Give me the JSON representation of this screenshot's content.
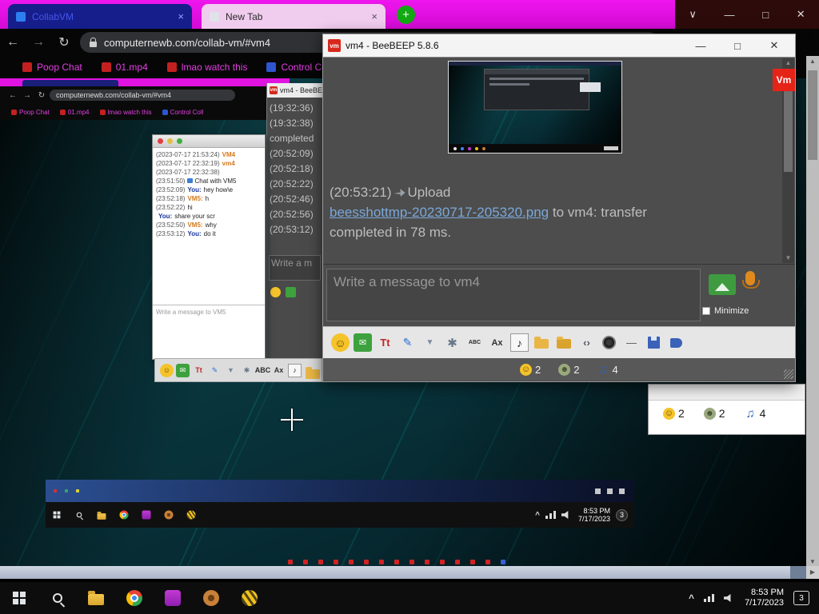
{
  "glyphs": {
    "back": "←",
    "fwd": "→",
    "reload": "↻",
    "plus": "+",
    "chev": "∨",
    "min": "—",
    "max": "□",
    "close": "✕",
    "tabclose": "×",
    "up": "▲",
    "down": "▼",
    "caret": "^",
    "right": "▶"
  },
  "browser": {
    "tab1": "CollabVM",
    "tab2": "New Tab",
    "address": "computernewb.com/collab-vm/#vm4",
    "bookmarks": [
      {
        "label": "Poop Chat",
        "cls": "bm-red"
      },
      {
        "label": "01.mp4",
        "cls": "bm-red"
      },
      {
        "label": "lmao watch this",
        "cls": "bm-red"
      },
      {
        "label": "Control Coll",
        "cls": "bm-blue"
      }
    ]
  },
  "page": {
    "logo": "Vm"
  },
  "beebeep": {
    "title": "vm4 - BeeBEEP 5.8.6",
    "icon_text": "vm",
    "msg": {
      "time": "(20:53:21)",
      "action": "Upload",
      "link": "beesshottmp-20230717-205320.png",
      "rest": "to vm4: transfer completed in 78 ms."
    },
    "placeholder": "Write a message to vm4",
    "minimize": "Minimize",
    "toolbar": [
      {
        "name": "emoticon-icon",
        "glyph": "☺",
        "cls": "i-smiley"
      },
      {
        "name": "send-file-icon",
        "glyph": "✉",
        "cls": "i-env"
      },
      {
        "name": "font-icon",
        "glyph": "Tt",
        "cls": "i-font"
      },
      {
        "name": "font-color-icon",
        "glyph": "✎",
        "cls": "i-pen"
      },
      {
        "name": "filter-icon",
        "glyph": "▼",
        "cls": "i-funnel"
      },
      {
        "name": "settings-icon",
        "glyph": "✱",
        "cls": "i-gear"
      },
      {
        "name": "spellcheck-icon",
        "glyph": "ABC",
        "cls": "i-abc"
      },
      {
        "name": "clear-format-icon",
        "glyph": "Ax",
        "cls": "i-ax"
      },
      {
        "name": "sound-icon",
        "glyph": "♪",
        "cls": "i-note"
      },
      {
        "name": "folder-add-icon",
        "glyph": "",
        "cls": "i-folder1"
      },
      {
        "name": "folder-send-icon",
        "glyph": "",
        "cls": "i-folder2"
      },
      {
        "name": "code-icon",
        "glyph": "‹›",
        "cls": "i-code"
      },
      {
        "name": "screenshot-icon",
        "glyph": "",
        "cls": "i-lens"
      },
      {
        "name": "horizontal-rule-icon",
        "glyph": "—",
        "cls": "i-hr"
      },
      {
        "name": "save-chat-icon",
        "glyph": "",
        "cls": "i-save"
      },
      {
        "name": "plugin-icon",
        "glyph": "",
        "cls": "i-boot"
      }
    ],
    "counts": [
      {
        "v": "2",
        "cls": "c-smiley",
        "name": "online-users-count"
      },
      {
        "v": "2",
        "cls": "c-users",
        "name": "connected-users-count"
      },
      {
        "v": "4",
        "cls": "c-notes",
        "name": "unread-chats-count"
      }
    ]
  },
  "beebeep_back": {
    "title": "vm4 - BeeBEE",
    "lines": [
      "(19:32:36)",
      "(19:32:38)",
      "completed",
      "(20:52:09)",
      "(20:52:18)",
      "(20:52:22)",
      "(20:52:46)",
      "(20:52:56)",
      "(20:53:12)"
    ],
    "placeholder": "Write a m"
  },
  "vm5": {
    "placeholder": "Write a message to VM5",
    "lines": [
      {
        "time": "(2023-07-17 21:53:24)",
        "who": "VM4",
        "wcls": "who-orange",
        "text": ""
      },
      {
        "time": "(2023-07-17 22:32:19)",
        "who": "vm4",
        "wcls": "who-orange",
        "text": ""
      },
      {
        "time": "(2023-07-17 22:32:38)",
        "who": "",
        "text": ""
      },
      {
        "time": "(23:51:50)",
        "who": "",
        "icls": "chaticon",
        "text": "Chat with VM5"
      },
      {
        "time": "(23:52:09)",
        "who": "You:",
        "wcls": "who-blue",
        "text": "hey how\\e"
      },
      {
        "time": "(23:52:18)",
        "who": "VM5:",
        "wcls": "who-orange",
        "text": "h"
      },
      {
        "time": "(23:52:22)",
        "who": "",
        "text": "hi"
      },
      {
        "time": "",
        "who": "You:",
        "wcls": "who-blue",
        "text": "share your scr"
      },
      {
        "time": "(23:52:50)",
        "who": "VM5:",
        "wcls": "who-orange",
        "text": "why"
      },
      {
        "time": "(23:53:12)",
        "who": "You:",
        "wcls": "who-blue",
        "text": "do it"
      }
    ]
  },
  "tray": {
    "time": "8:53 PM",
    "date": "7/17/2023",
    "badge": "3"
  },
  "nested_tray": {
    "time": "8:53 PM",
    "date": "7/17/2023",
    "badge": "3"
  }
}
